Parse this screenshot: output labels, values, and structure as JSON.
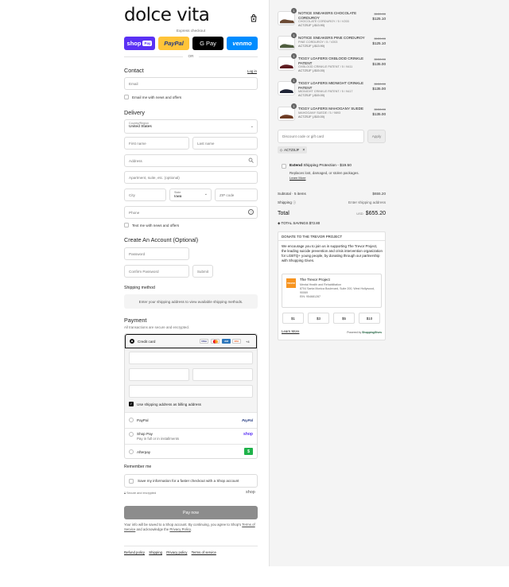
{
  "brand": {
    "name": "dolce vita"
  },
  "express": {
    "label": "Express checkout",
    "buttons": [
      {
        "label": "shop",
        "badge": "Pay",
        "color": "#5a31f4"
      },
      {
        "label": "PayPal",
        "color": "#ffc439"
      },
      {
        "label": "G Pay",
        "color": "#000000"
      },
      {
        "label": "venmo",
        "color": "#008cff"
      }
    ],
    "or": "OR"
  },
  "contact": {
    "title": "Contact",
    "login": "Log in",
    "email_placeholder": "Email",
    "news_label": "Email me with news and offers"
  },
  "delivery": {
    "title": "Delivery",
    "country_label": "Country/Region",
    "country_value": "United States",
    "first_name": "First name",
    "last_name": "Last name",
    "address": "Address",
    "apartment": "Apartment, suite, etc. (optional)",
    "city": "City",
    "state_label": "State",
    "state_value": "Iowa",
    "zip": "ZIP code",
    "phone": "Phone",
    "text_news": "Text me with news and offers"
  },
  "account": {
    "title": "Create An Account (Optional)",
    "password": "Password",
    "confirm": "Confirm Password",
    "submit": "Submit"
  },
  "shipping": {
    "title": "Shipping method",
    "info": "Enter your shipping address to view available shipping methods."
  },
  "payment": {
    "title": "Payment",
    "subtitle": "All transactions are secure and encrypted.",
    "credit_card": "Credit card",
    "card_more": "+4",
    "billing_same": "Use shipping address as billing address",
    "paypal": "PayPal",
    "paypal_logo": "PayPal",
    "shoppay": "Shop Pay",
    "shoppay_sub": "Pay in full or in installments",
    "shoppay_logo": "shop",
    "afterpay": "Afterpay",
    "afterpay_logo": "$"
  },
  "remember": {
    "title": "Remember me",
    "save_label": "Save my information for a faster checkout with a Shop account",
    "secure": "Secure and encrypted",
    "shop_logo": "shop"
  },
  "paynow": "Pay now",
  "legal": {
    "text1": "Your info will be saved to a Shop account. By continuing, you agree to Shop's",
    "terms": "Terms of Service",
    "text2": "and acknowledge the",
    "privacy": "Privacy Policy",
    "end": "."
  },
  "footer": [
    "Refund policy",
    "Shipping",
    "Privacy policy",
    "Terms of service"
  ],
  "cart": {
    "items": [
      {
        "qty": "1",
        "name": "NOTICE SNEAKERS CHOCOLATE CORDUROY",
        "variant": "CHOCOLATE CORDUROY / 5 / V203",
        "discount": "ACTZSJF (-$13.90)",
        "orig": "$139.00",
        "price": "$125.10"
      },
      {
        "qty": "1",
        "name": "NOTICE SNEAKERS PINE CORDUROY",
        "variant": "PINE CORDUROY / 5 / V203",
        "discount": "ACTZSJF (-$13.90)",
        "orig": "$139.00",
        "price": "$125.10"
      },
      {
        "qty": "1",
        "name": "TIGGY LOAFERS OXBLOOD CRINKLE PATENT",
        "variant": "OXBLOOD CRINKLE PATENT / 5 / 9411",
        "discount": "ACTZSJF (-$15.00)",
        "orig": "$150.00",
        "price": "$135.00"
      },
      {
        "qty": "1",
        "name": "TIGGY LOAFERS MIDNIGHT CRINKLE PATENT",
        "variant": "MIDNIGHT CRINKLE PATENT / 5 / 9417",
        "discount": "ACTZSJF (-$15.00)",
        "orig": "$150.00",
        "price": "$135.00"
      },
      {
        "qty": "1",
        "name": "TIGGY LOAFERS MAHOGANY SUEDE",
        "variant": "MAHOGANY SUEDE / 5 / 9893",
        "discount": "ACTZSJF (-$15.00)",
        "orig": "$150.00",
        "price": "$135.00"
      }
    ],
    "discount_placeholder": "Discount code or gift card",
    "apply": "Apply",
    "code_chip": "ACTZSJF"
  },
  "extend": {
    "brand": "Extend",
    "title": "Shipping Protection - $19.50",
    "desc": "Replaces lost, damaged, or stolen packages.",
    "learn": "Learn More"
  },
  "summary": {
    "subtotal_label": "Subtotal · 5 items",
    "subtotal": "$655.20",
    "shipping_label": "Shipping",
    "shipping_value": "Enter shipping address",
    "total_label": "Total",
    "currency": "USD",
    "total": "$655.20",
    "savings": "TOTAL SAVINGS $72.80"
  },
  "donation": {
    "header": "DONATE TO THE TREVOR PROJECT",
    "body": "We encourage you to join us in supporting The Trevor Project, the leading suicide prevention and crisis intervention organization for LGBTQ+ young people, by donating through our partnership with Shopping Gives.",
    "org_name": "The Trevor Project",
    "org_cat": "Mental Health and Rehabilitation",
    "org_addr": "8704 Santa Monica Boulevard, Suite 200, West Hollywood, 90069",
    "org_ein": "EIN: 954681287",
    "logo_text": "TREVOR",
    "amounts": [
      "$1",
      "$3",
      "$5",
      "$10"
    ],
    "learn": "Learn More",
    "powered": "Powered by",
    "powered_brand": "ShoppingGives"
  }
}
